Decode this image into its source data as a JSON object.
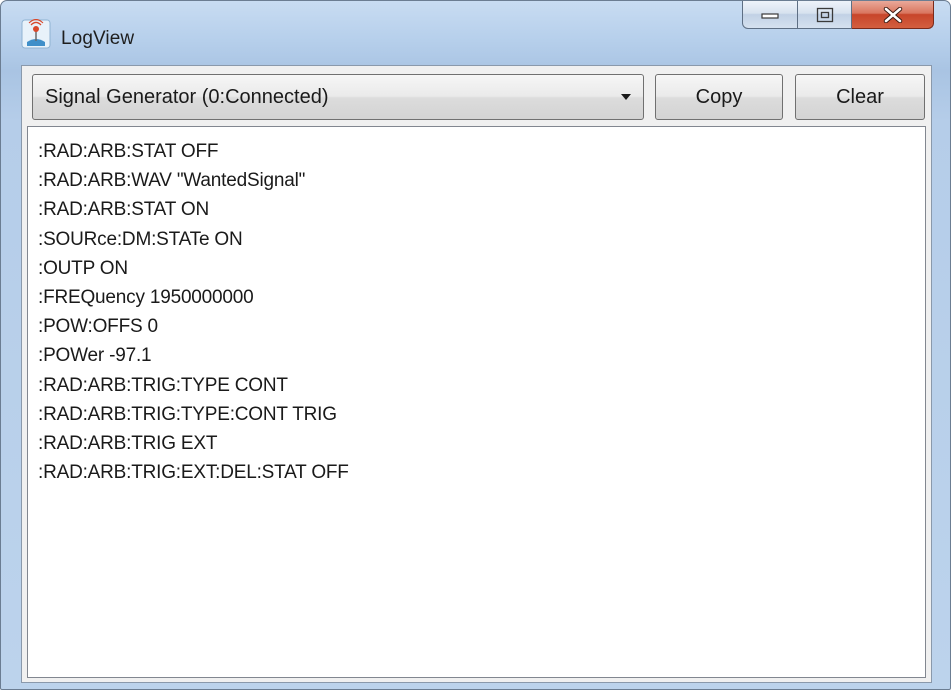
{
  "window": {
    "title": "LogView",
    "icon": "antenna-icon",
    "caption_buttons": [
      "minimize-icon",
      "maximize-icon",
      "close-icon"
    ]
  },
  "toolbar": {
    "device_select": {
      "value": "Signal Generator (0:Connected)"
    },
    "copy_label": "Copy",
    "clear_label": "Clear"
  },
  "log": {
    "lines": [
      ":RAD:ARB:STAT OFF",
      ":RAD:ARB:WAV \"WantedSignal\"",
      ":RAD:ARB:STAT ON",
      ":SOURce:DM:STATe ON",
      ":OUTP ON",
      ":FREQuency 1950000000",
      ":POW:OFFS 0",
      ":POWer -97.1",
      ":RAD:ARB:TRIG:TYPE CONT",
      ":RAD:ARB:TRIG:TYPE:CONT TRIG",
      ":RAD:ARB:TRIG EXT",
      ":RAD:ARB:TRIG:EXT:DEL:STAT OFF"
    ]
  },
  "colors": {
    "frame": "#b6cfeb",
    "close_button": "#c7452a",
    "log_background": "#ffffff"
  }
}
